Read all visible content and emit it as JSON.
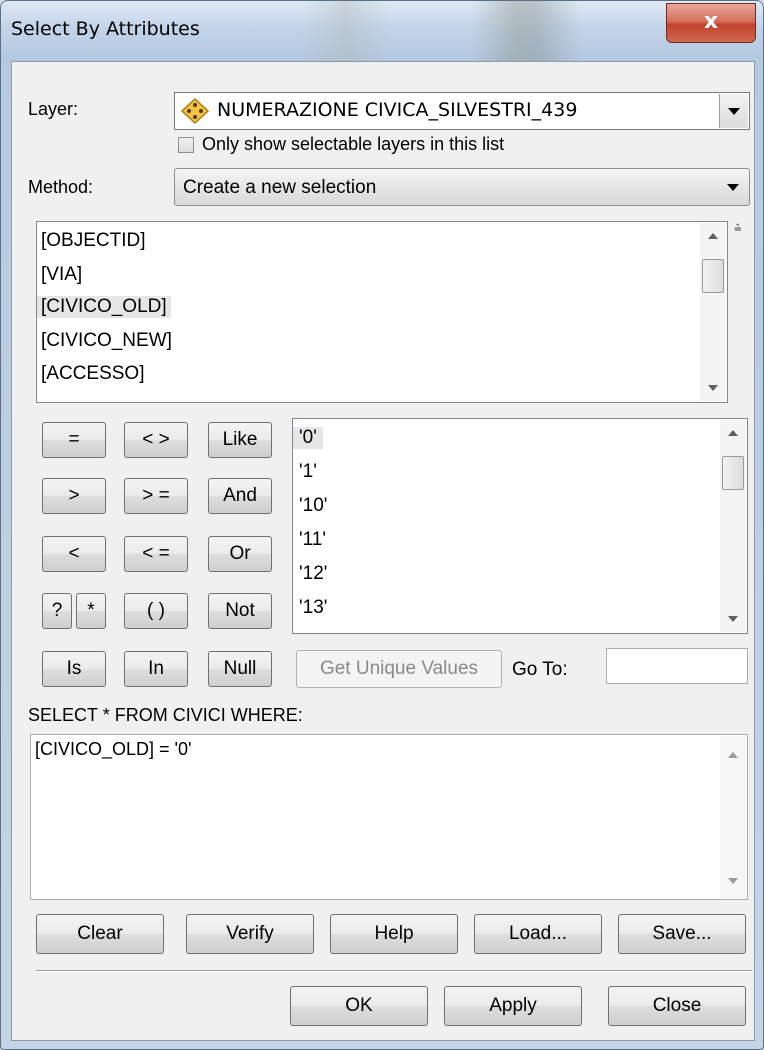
{
  "window": {
    "title": "Select By Attributes",
    "close_glyph": "x"
  },
  "layer": {
    "label": "Layer:",
    "value": "NUMERAZIONE CIVICA_SILVESTRI_439",
    "icon": "feature-layer-icon",
    "only_selectable_label": "Only show selectable layers in this list",
    "only_selectable_checked": false
  },
  "method": {
    "label": "Method:",
    "value": "Create a new selection"
  },
  "fields": {
    "items": [
      "[OBJECTID]",
      "[VIA]",
      "[CIVICO_OLD]",
      "[CIVICO_NEW]",
      "[ACCESSO]"
    ],
    "selected": "[CIVICO_OLD]"
  },
  "operators": {
    "eq": "=",
    "ne": "< >",
    "like": "Like",
    "gt": ">",
    "ge": "> =",
    "and": "And",
    "lt": "<",
    "le": "< =",
    "or": "Or",
    "q": "?",
    "star": "*",
    "paren": "( )",
    "not": "Not",
    "is": "Is",
    "in": "In",
    "null": "Null"
  },
  "values": {
    "items": [
      "'0'",
      "'1'",
      "'10'",
      "'11'",
      "'12'",
      "'13'"
    ],
    "selected": "'0'",
    "get_unique_label": "Get Unique Values",
    "goto_label": "Go To:",
    "goto_value": ""
  },
  "query": {
    "label": "SELECT * FROM CIVICI WHERE:",
    "expression": "[CIVICO_OLD] = '0'"
  },
  "actions": {
    "clear": "Clear",
    "verify": "Verify",
    "help": "Help",
    "load": "Load...",
    "save": "Save..."
  },
  "footer": {
    "ok": "OK",
    "apply": "Apply",
    "close": "Close"
  },
  "colors": {
    "titlebar": "#c3d4e9",
    "close_button": "#c2432a",
    "dialog_bg": "#f0f0f0",
    "selection": "#e6e6e6"
  }
}
